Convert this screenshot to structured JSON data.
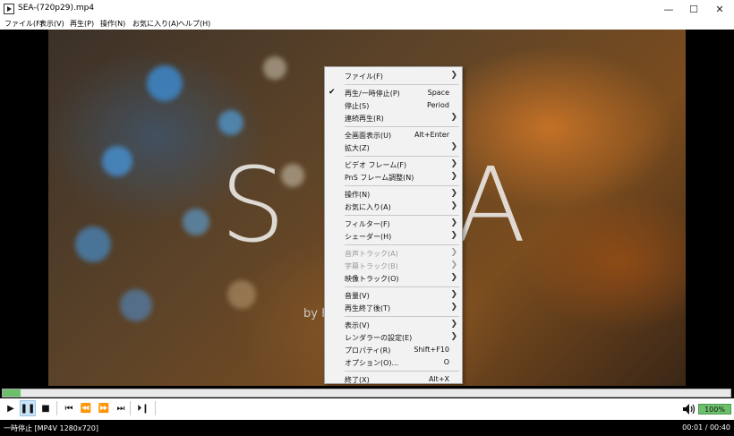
{
  "window": {
    "title": "SEA-(720p29).mp4"
  },
  "menubar": [
    {
      "label": "ファイル(F)"
    },
    {
      "label": "表示(V)"
    },
    {
      "label": "再生(P)"
    },
    {
      "label": "操作(N)"
    },
    {
      "label": "お気に入り(A)"
    },
    {
      "label": "ヘルプ(H)"
    }
  ],
  "video": {
    "big_left": "S",
    "big_right": "A",
    "byline": "by K"
  },
  "context_menu": [
    {
      "type": "item",
      "label": "ファイル(F)",
      "submenu": true
    },
    {
      "type": "sep"
    },
    {
      "type": "item",
      "label": "再生/一時停止(P)",
      "shortcut": "Space",
      "checked": true
    },
    {
      "type": "item",
      "label": "停止(S)",
      "shortcut": "Period"
    },
    {
      "type": "item",
      "label": "連続再生(R)",
      "submenu": true
    },
    {
      "type": "sep"
    },
    {
      "type": "item",
      "label": "全画面表示(U)",
      "shortcut": "Alt+Enter"
    },
    {
      "type": "item",
      "label": "拡大(Z)",
      "submenu": true
    },
    {
      "type": "sep"
    },
    {
      "type": "item",
      "label": "ビデオ フレーム(F)",
      "submenu": true
    },
    {
      "type": "item",
      "label": "PnS フレーム調整(N)",
      "submenu": true
    },
    {
      "type": "sep"
    },
    {
      "type": "item",
      "label": "操作(N)",
      "submenu": true
    },
    {
      "type": "item",
      "label": "お気に入り(A)",
      "submenu": true
    },
    {
      "type": "sep"
    },
    {
      "type": "item",
      "label": "フィルター(F)",
      "submenu": true
    },
    {
      "type": "item",
      "label": "シェーダー(H)",
      "submenu": true
    },
    {
      "type": "sep"
    },
    {
      "type": "item",
      "label": "音声トラック(A)",
      "submenu": true,
      "disabled": true
    },
    {
      "type": "item",
      "label": "字幕トラック(B)",
      "submenu": true,
      "disabled": true
    },
    {
      "type": "item",
      "label": "映像トラック(O)",
      "submenu": true
    },
    {
      "type": "sep"
    },
    {
      "type": "item",
      "label": "音量(V)",
      "submenu": true
    },
    {
      "type": "item",
      "label": "再生終了後(T)",
      "submenu": true
    },
    {
      "type": "sep"
    },
    {
      "type": "item",
      "label": "表示(V)",
      "submenu": true
    },
    {
      "type": "item",
      "label": "レンダラーの設定(E)",
      "submenu": true
    },
    {
      "type": "item",
      "label": "プロパティ(R)",
      "shortcut": "Shift+F10"
    },
    {
      "type": "item",
      "label": "オプション(O)...",
      "shortcut": "O"
    },
    {
      "type": "sep"
    },
    {
      "type": "item",
      "label": "終了(X)",
      "shortcut": "Alt+X"
    }
  ],
  "seek": {
    "progress": 0.025
  },
  "controls": {
    "buttons": [
      {
        "name": "play-button",
        "glyph": "▶"
      },
      {
        "name": "pause-button",
        "glyph": "❚❚",
        "active": true
      },
      {
        "name": "stop-button",
        "glyph": "■"
      },
      {
        "name": "skip-previous-button",
        "glyph": "⏮"
      },
      {
        "name": "rewind-button",
        "glyph": "⏪"
      },
      {
        "name": "fast-forward-button",
        "glyph": "⏩"
      },
      {
        "name": "skip-next-button",
        "glyph": "⏭"
      },
      {
        "name": "frame-step-button",
        "glyph": "⏵❙"
      }
    ],
    "volume_label": "100%"
  },
  "status": {
    "left": "一時停止 [MP4V 1280x720]",
    "right": "00:01 / 00:40"
  },
  "colors": {
    "seek_fill": "#6cc06c",
    "menu_bg": "#f2f2f2"
  }
}
